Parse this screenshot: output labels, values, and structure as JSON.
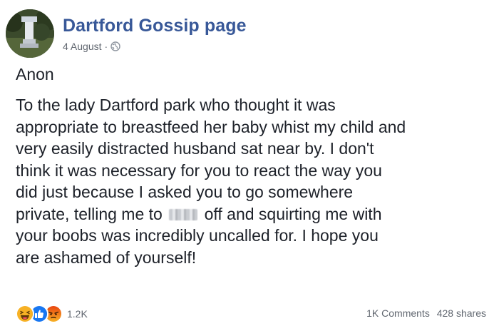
{
  "header": {
    "page_name": "Dartford Gossip page",
    "date": "4 August",
    "separator": "·",
    "privacy_icon": "globe-icon"
  },
  "post": {
    "author": "Anon",
    "lines": [
      "To the lady Dartford park who thought it was",
      "appropriate to breastfeed her baby whist my child and",
      "very easily distracted husband sat near by. I don't",
      "think it was necessary for you to react the way you",
      "did just because I asked you to go somewhere",
      "private, telling me to",
      "off and squirting me with",
      "your boobs was incredibly uncalled for. I hope you",
      "are ashamed of yourself!"
    ]
  },
  "footer": {
    "reaction_icons": [
      "haha-icon",
      "like-icon",
      "angry-icon"
    ],
    "reaction_count": "1.2K",
    "comments": "1K Comments",
    "shares": "428 shares"
  },
  "colors": {
    "page_name": "#385898",
    "text": "#1d2129",
    "meta": "#616770",
    "like": "#1877f2",
    "haha": "#f7b125",
    "angry": "#e9710f"
  }
}
